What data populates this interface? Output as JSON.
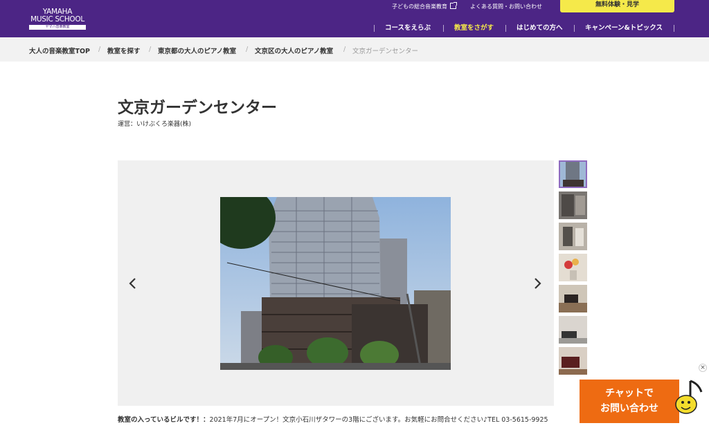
{
  "header": {
    "logo_line1": "YAMAHA",
    "logo_line2": "MUSIC SCHOOL",
    "logo_sub": "ヤマハ音楽教室",
    "util_links": [
      "子どもの総合音楽教育",
      "よくある質問・お問い合わせ"
    ],
    "cta_trial": "無料体験・見学",
    "nav": [
      "コースをえらぶ",
      "教室をさがす",
      "はじめての方へ",
      "キャンペーン&トピックス"
    ],
    "active_nav": "教室をさがす",
    "colors": {
      "bar": "#4c2585",
      "active": "#f5e94a"
    }
  },
  "breadcrumb": {
    "items": [
      "大人の音楽教室TOP",
      "教室を探す",
      "東京都の大人のピアノ教室",
      "文京区の大人のピアノ教室",
      "文京ガーデンセンター"
    ],
    "separator": "/"
  },
  "page": {
    "title": "文京ガーデンセンター",
    "operator": "運営：いけぶくろ楽器(株)"
  },
  "gallery": {
    "prev_icon": "chevron-left-icon",
    "next_icon": "chevron-right-icon",
    "active_index": 0,
    "caption_bold": "教室の入っているビルです！：",
    "caption_text": "2021年7月にオープン！文京小石川ザタワーの3階にございます。お気軽にお問合せください♪TEL 03-5615-9925"
  },
  "chat": {
    "line1": "チャットで",
    "line2": "お問い合わせ",
    "close": "×",
    "color": "#ee6b12"
  }
}
